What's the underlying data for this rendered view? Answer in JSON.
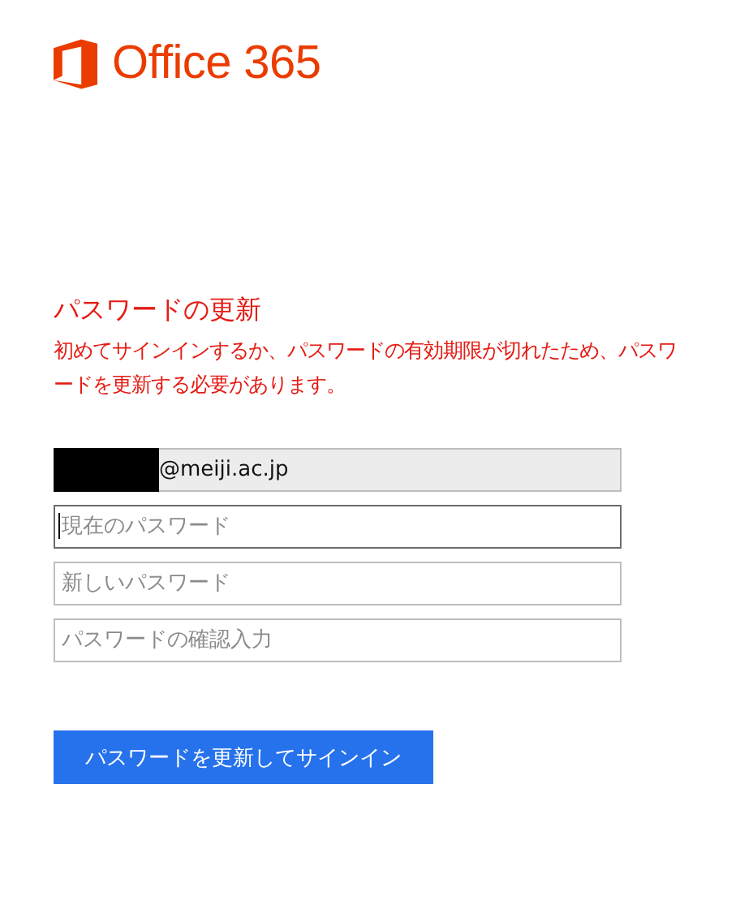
{
  "logo": {
    "text": "Office 365"
  },
  "heading": "パスワードの更新",
  "message": "初めてサインインするか、パスワードの有効期限が切れたため、パスワードを更新する必要があります。",
  "fields": [
    {
      "value": "@meiji.ac.jp",
      "redacted": true,
      "disabled": true,
      "focused": false
    },
    {
      "placeholder": "現在のパスワード",
      "redacted": false,
      "disabled": false,
      "focused": true
    },
    {
      "placeholder": "新しいパスワード",
      "redacted": false,
      "disabled": false,
      "focused": false
    },
    {
      "placeholder": "パスワードの確認入力",
      "redacted": false,
      "disabled": false,
      "focused": false
    }
  ],
  "submit_button": "パスワードを更新してサインイン"
}
